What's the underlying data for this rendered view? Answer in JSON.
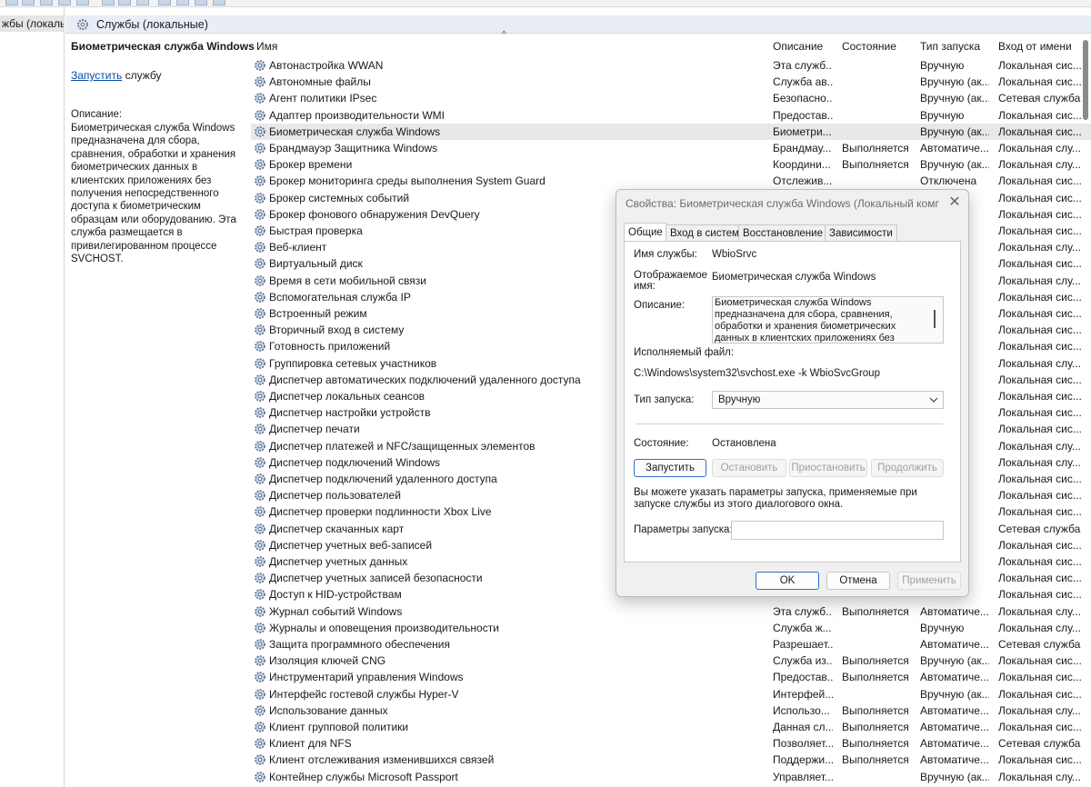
{
  "tree": {
    "selected_item": "жбы (локалы"
  },
  "header": {
    "title": "Службы (локальные)"
  },
  "detail": {
    "title": "Биометрическая служба Windows",
    "start_link": "Запустить",
    "start_suffix": " службу",
    "description_label": "Описание:",
    "description": "Биометрическая служба Windows предназначена для сбора, сравнения, обработки и хранения биометрических данных в клиентских приложениях без получения непосредственного доступа к биометрическим образцам или оборудованию. Эта служба размещается в привилегированном процессе SVCHOST."
  },
  "list": {
    "columns": [
      "Имя",
      "Описание",
      "Состояние",
      "Тип запуска",
      "Вход от имени"
    ],
    "sort_indicator": "^",
    "selected_index": 4,
    "rows": [
      [
        "Автонастройка WWAN",
        "Эта служб...",
        "",
        "Вручную",
        "Локальная сис..."
      ],
      [
        "Автономные файлы",
        "Служба ав...",
        "",
        "Вручную (ак...",
        "Локальная сис..."
      ],
      [
        "Агент политики IPsec",
        "Безопасно...",
        "",
        "Вручную (ак...",
        "Сетевая служба"
      ],
      [
        "Адаптер производительности WMI",
        "Предостав...",
        "",
        "Вручную",
        "Локальная сис..."
      ],
      [
        "Биометрическая служба Windows",
        "Биометри...",
        "",
        "Вручную (ак...",
        "Локальная сис..."
      ],
      [
        "Брандмауэр Защитника Windows",
        "Брандмау...",
        "Выполняется",
        "Автоматиче...",
        "Локальная слу..."
      ],
      [
        "Брокер времени",
        "Координи...",
        "Выполняется",
        "Вручную (ак...",
        "Локальная слу..."
      ],
      [
        "Брокер мониторинга среды выполнения System Guard",
        "Отслежив...",
        "",
        "Отключена",
        "Локальная сис..."
      ],
      [
        "Брокер системных событий",
        "",
        "",
        "че...",
        "Локальная сис..."
      ],
      [
        "Брокер фонового обнаружения DevQuery",
        "",
        "",
        "ак...",
        "Локальная сис..."
      ],
      [
        "Быстрая проверка",
        "",
        "",
        "ак...",
        "Локальная сис..."
      ],
      [
        "Веб-клиент",
        "",
        "",
        "ак...",
        "Локальная слу..."
      ],
      [
        "Виртуальный диск",
        "",
        "",
        "",
        "Локальная сис..."
      ],
      [
        "Время в сети мобильной связи",
        "",
        "",
        "ак...",
        "Локальная слу..."
      ],
      [
        "Вспомогательная служба IP",
        "",
        "",
        "че...",
        "Локальная сис..."
      ],
      [
        "Встроенный режим",
        "",
        "",
        "ак...",
        "Локальная сис..."
      ],
      [
        "Вторичный вход в систему",
        "",
        "",
        "",
        "Локальная сис..."
      ],
      [
        "Готовность приложений",
        "",
        "",
        "",
        "Локальная сис..."
      ],
      [
        "Группировка сетевых участников",
        "",
        "",
        "",
        "Локальная слу..."
      ],
      [
        "Диспетчер автоматических подключений удаленного доступа",
        "",
        "",
        "",
        "Локальная сис..."
      ],
      [
        "Диспетчер локальных сеансов",
        "",
        "",
        "че...",
        "Локальная сис..."
      ],
      [
        "Диспетчер настройки устройств",
        "",
        "",
        "ак...",
        "Локальная сис..."
      ],
      [
        "Диспетчер печати",
        "",
        "",
        "че...",
        "Локальная сис..."
      ],
      [
        "Диспетчер платежей и NFC/защищенных элементов",
        "",
        "",
        "ак...",
        "Локальная слу..."
      ],
      [
        "Диспетчер подключений Windows",
        "",
        "",
        "ак...",
        "Локальная слу..."
      ],
      [
        "Диспетчер подключений удаленного доступа",
        "",
        "",
        "",
        "Локальная сис..."
      ],
      [
        "Диспетчер пользователей",
        "",
        "",
        "че...",
        "Локальная сис..."
      ],
      [
        "Диспетчер проверки подлинности Xbox Live",
        "",
        "",
        "",
        "Локальная сис..."
      ],
      [
        "Диспетчер скачанных карт",
        "",
        "",
        "че...",
        "Сетевая служба"
      ],
      [
        "Диспетчер учетных веб-записей",
        "",
        "",
        "",
        "Локальная сис..."
      ],
      [
        "Диспетчер учетных данных",
        "",
        "",
        "",
        "Локальная сис..."
      ],
      [
        "Диспетчер учетных записей безопасности",
        "",
        "",
        "че...",
        "Локальная сис..."
      ],
      [
        "Доступ к HID-устройствам",
        "",
        "",
        "",
        "Локальная сис..."
      ],
      [
        "Журнал событий Windows",
        "Эта служб...",
        "Выполняется",
        "Автоматиче...",
        "Локальная слу..."
      ],
      [
        "Журналы и оповещения производительности",
        "Служба ж...",
        "",
        "Вручную",
        "Локальная слу..."
      ],
      [
        "Защита программного обеспечения",
        "Разрешает...",
        "",
        "Автоматиче...",
        "Сетевая служба"
      ],
      [
        "Изоляция ключей CNG",
        "Служба из...",
        "Выполняется",
        "Вручную (ак...",
        "Локальная сис..."
      ],
      [
        "Инструментарий управления Windows",
        "Предостав...",
        "Выполняется",
        "Автоматиче...",
        "Локальная сис..."
      ],
      [
        "Интерфейс гостевой службы Hyper-V",
        "Интерфей...",
        "",
        "Вручную (ак...",
        "Локальная сис..."
      ],
      [
        "Использование данных",
        "Использо...",
        "Выполняется",
        "Автоматиче...",
        "Локальная слу..."
      ],
      [
        "Клиент групповой политики",
        "Данная сл...",
        "Выполняется",
        "Автоматиче...",
        "Локальная сис..."
      ],
      [
        "Клиент для NFS",
        "Позволяет...",
        "Выполняется",
        "Автоматиче...",
        "Сетевая служба"
      ],
      [
        "Клиент отслеживания изменившихся связей",
        "Поддержи...",
        "Выполняется",
        "Автоматиче...",
        "Локальная сис..."
      ],
      [
        "Контейнер службы Microsoft Passport",
        "Управляет...",
        "",
        "Вручную (ак...",
        "Локальная слу..."
      ]
    ]
  },
  "dialog": {
    "title": "Свойства: Биометрическая служба Windows (Локальный компь...",
    "close_glyph": "✕",
    "tabs": [
      "Общие",
      "Вход в систему",
      "Восстановление",
      "Зависимости"
    ],
    "service_name_label": "Имя службы:",
    "service_name": "WbioSrvc",
    "display_name_label": "Отображаемое имя:",
    "display_name": "Биометрическая служба Windows",
    "description_label": "Описание:",
    "description": "Биометрическая служба Windows предназначена для сбора, сравнения, обработки и хранения биометрических данных в клиентских приложениях без получения",
    "exe_label": "Исполняемый файл:",
    "exe_path": "C:\\Windows\\system32\\svchost.exe -k WbioSvcGroup",
    "startup_label": "Тип запуска:",
    "startup_value": "Вручную",
    "status_label": "Состояние:",
    "status_value": "Остановлена",
    "btn_start": "Запустить",
    "btn_stop": "Остановить",
    "btn_pause": "Приостановить",
    "btn_resume": "Продолжить",
    "note": "Вы можете указать параметры запуска, применяемые при запуске службы из этого диалогового окна.",
    "params_label": "Параметры запуска:",
    "params_value": "",
    "ok": "OK",
    "cancel": "Отмена",
    "apply": "Применить"
  }
}
